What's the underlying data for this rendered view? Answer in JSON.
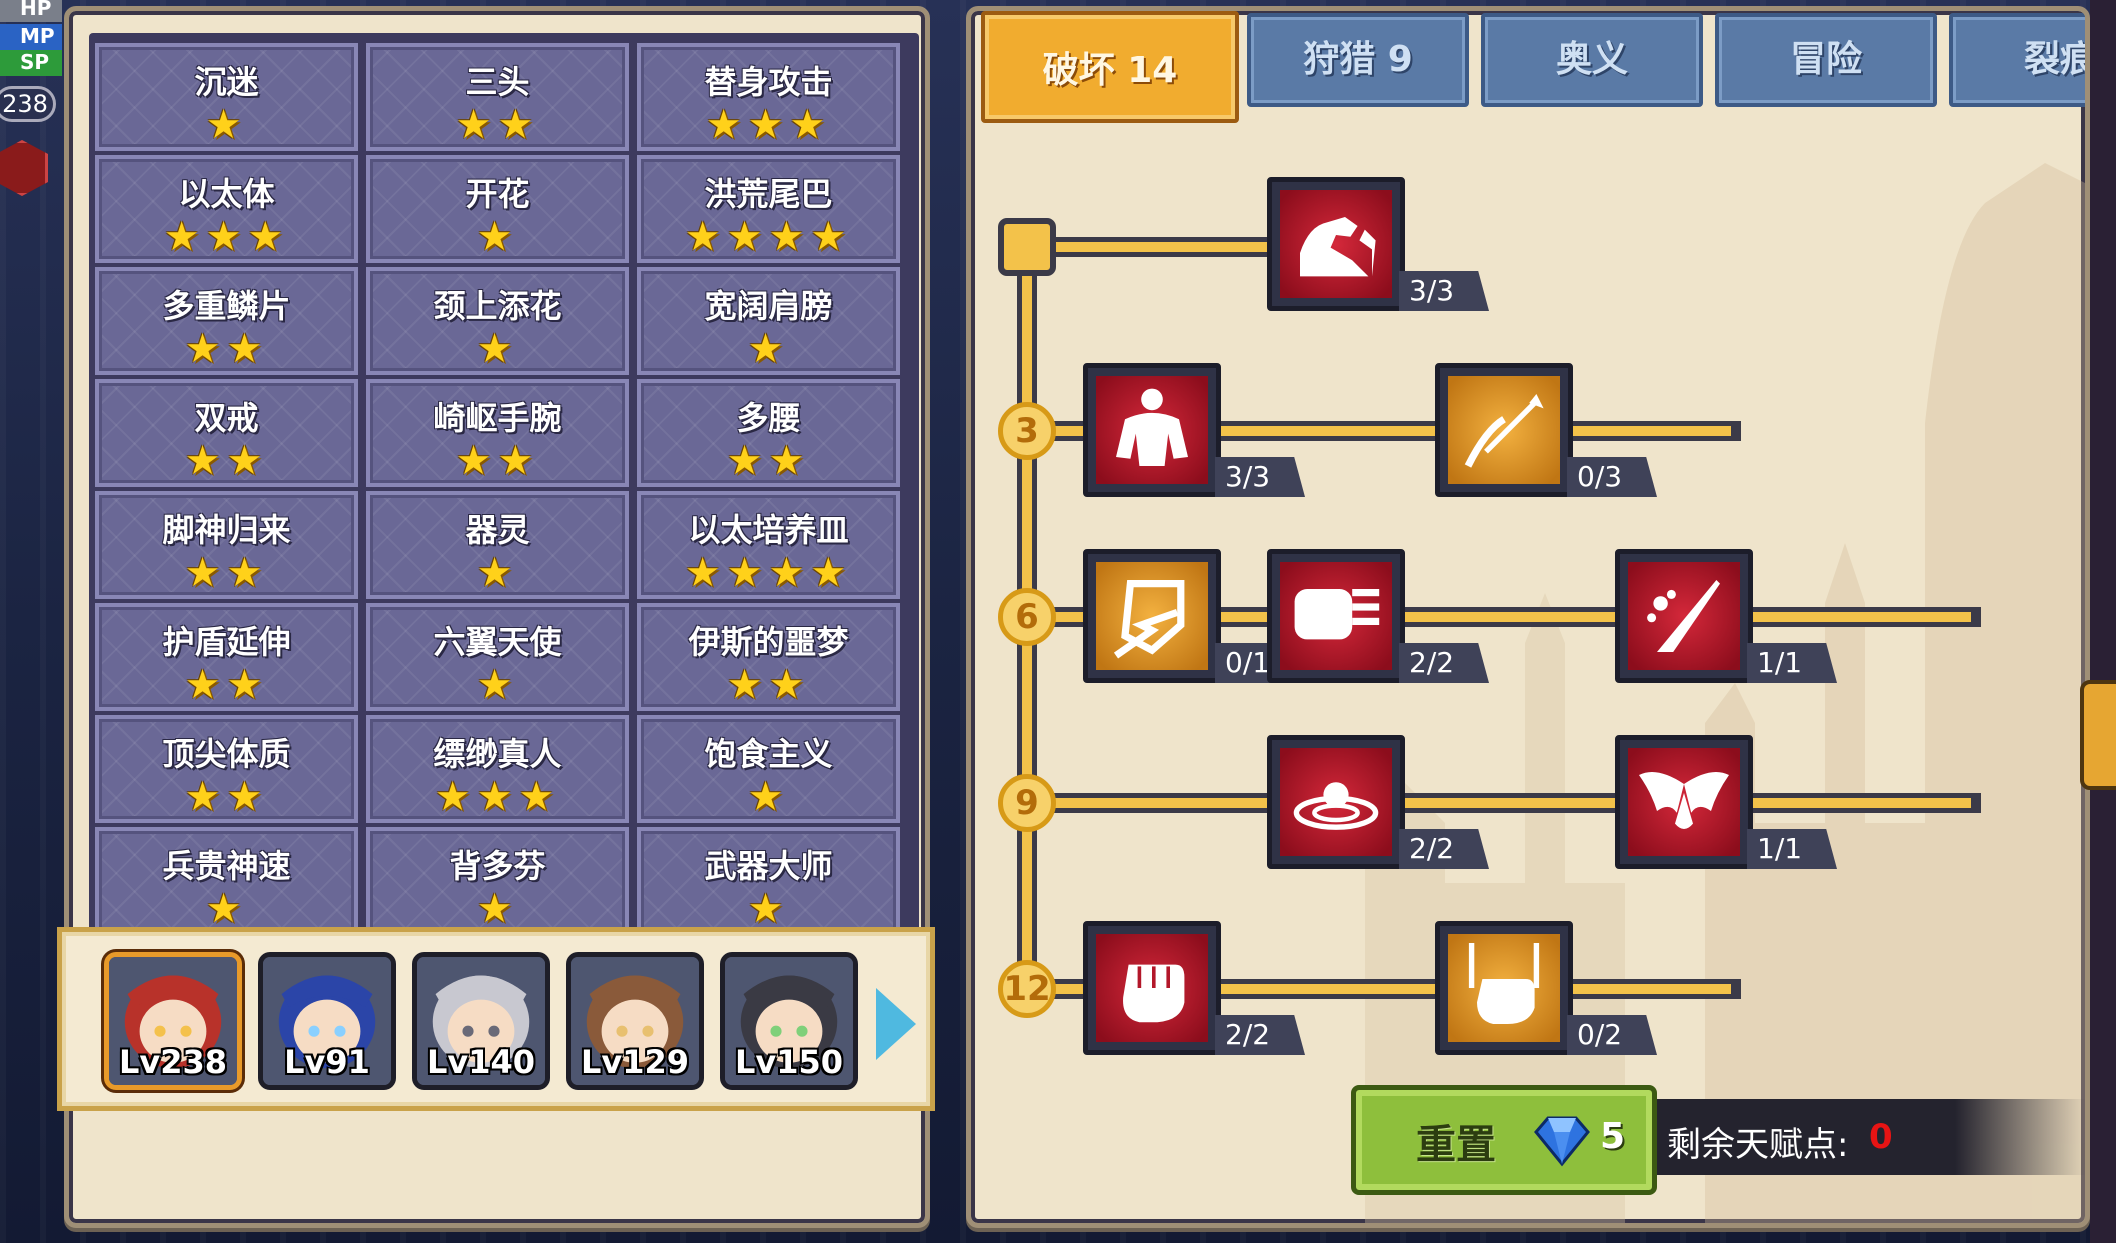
{
  "hud": {
    "hp": "HP",
    "mp": "MP",
    "sp": "SP",
    "level": "238"
  },
  "talents": [
    {
      "name": "沉迷",
      "stars": "★"
    },
    {
      "name": "三头",
      "stars": "★★"
    },
    {
      "name": "替身攻击",
      "stars": "★★★"
    },
    {
      "name": "以太体",
      "stars": "★★★"
    },
    {
      "name": "开花",
      "stars": "★"
    },
    {
      "name": "洪荒尾巴",
      "stars": "★★★★"
    },
    {
      "name": "多重鳞片",
      "stars": "★★"
    },
    {
      "name": "颈上添花",
      "stars": "★"
    },
    {
      "name": "宽阔肩膀",
      "stars": "★"
    },
    {
      "name": "双戒",
      "stars": "★★"
    },
    {
      "name": "崎岖手腕",
      "stars": "★★"
    },
    {
      "name": "多腰",
      "stars": "★★"
    },
    {
      "name": "脚神归来",
      "stars": "★★"
    },
    {
      "name": "器灵",
      "stars": "★"
    },
    {
      "name": "以太培养皿",
      "stars": "★★★★"
    },
    {
      "name": "护盾延伸",
      "stars": "★★"
    },
    {
      "name": "六翼天使",
      "stars": "★"
    },
    {
      "name": "伊斯的噩梦",
      "stars": "★★"
    },
    {
      "name": "顶尖体质",
      "stars": "★★"
    },
    {
      "name": "缥缈真人",
      "stars": "★★★"
    },
    {
      "name": "饱食主义",
      "stars": "★"
    },
    {
      "name": "兵贵神速",
      "stars": "★"
    },
    {
      "name": "背多芬",
      "stars": "★"
    },
    {
      "name": "武器大师",
      "stars": "★"
    }
  ],
  "heroes": [
    {
      "level": "Lv238",
      "selected": true
    },
    {
      "level": "Lv91"
    },
    {
      "level": "Lv140"
    },
    {
      "level": "Lv129"
    },
    {
      "level": "Lv150"
    }
  ],
  "tabs": [
    {
      "label": "破坏 14",
      "active": true
    },
    {
      "label": "狩猎 9"
    },
    {
      "label": "奥义"
    },
    {
      "label": "冒险"
    },
    {
      "label": "裂痕"
    }
  ],
  "tree": {
    "levels": [
      "3",
      "6",
      "9",
      "12"
    ],
    "nodes": [
      {
        "icon": "arm-wrestle-icon",
        "color": "red",
        "count": "3/3"
      },
      {
        "icon": "muscle-body-icon",
        "color": "red",
        "count": "3/3"
      },
      {
        "icon": "arrow-hit-icon",
        "color": "gold",
        "count": "0/3"
      },
      {
        "icon": "shield-break-icon",
        "color": "gold",
        "count": "0/1"
      },
      {
        "icon": "punch-icon",
        "color": "red",
        "count": "2/2"
      },
      {
        "icon": "slash-icon",
        "color": "red",
        "count": "1/1"
      },
      {
        "icon": "ripple-icon",
        "color": "red",
        "count": "2/2"
      },
      {
        "icon": "bat-wing-icon",
        "color": "red",
        "count": "1/1"
      },
      {
        "icon": "fist-icon",
        "color": "red",
        "count": "2/2"
      },
      {
        "icon": "fist-rays-icon",
        "color": "gold",
        "count": "0/2"
      }
    ]
  },
  "reset": {
    "label": "重置",
    "cost": "5"
  },
  "points": {
    "label": "剩余天赋点:",
    "value": "0"
  },
  "colors": {
    "accent": "#f1ac2f",
    "tab_inactive": "#5a7aa6",
    "node_red": "#b3172a",
    "node_gold": "#e3961f",
    "points_value": "#e81414"
  }
}
